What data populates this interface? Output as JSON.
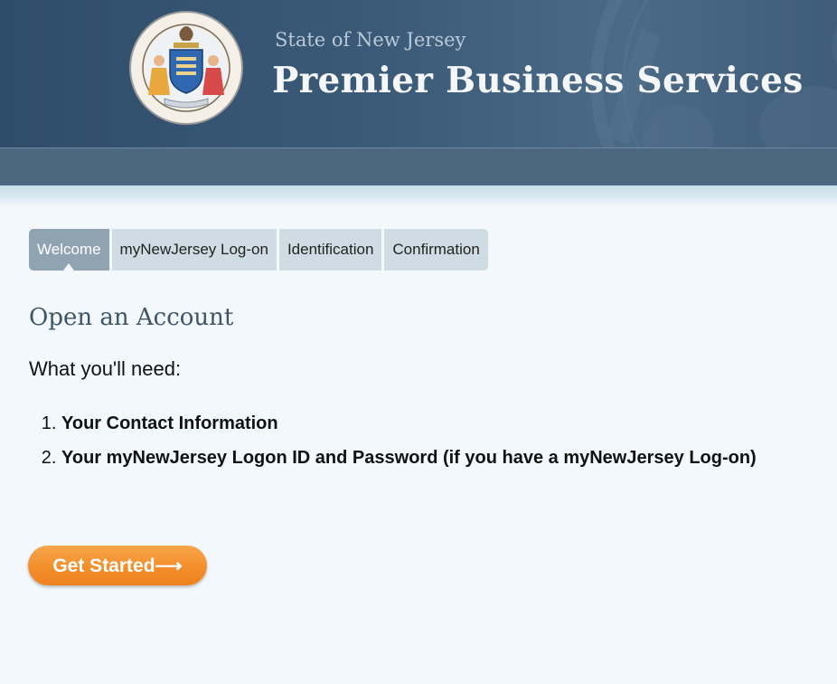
{
  "header": {
    "state": "State of New Jersey",
    "title": "Premier Business Services",
    "seal_icon": "nj-state-seal-icon"
  },
  "steps": [
    {
      "label": "Welcome",
      "active": true
    },
    {
      "label": "myNewJersey Log-on",
      "active": false
    },
    {
      "label": "Identification",
      "active": false
    },
    {
      "label": "Confirmation",
      "active": false
    }
  ],
  "main": {
    "title": "Open an Account",
    "need_label": "What you'll need:",
    "requirements": [
      "Your Contact Information",
      "Your myNewJersey Logon ID and Password (if you have a myNewJersey Log-on)"
    ],
    "cta_label": "Get Started⟶"
  },
  "colors": {
    "header_bg": "#2f4d69",
    "navbar_bg": "#4b6880",
    "active_step": "#8fa3b1",
    "inactive_step": "#cfdce4",
    "cta": "#f28e2b",
    "title_text": "#3d5568"
  }
}
